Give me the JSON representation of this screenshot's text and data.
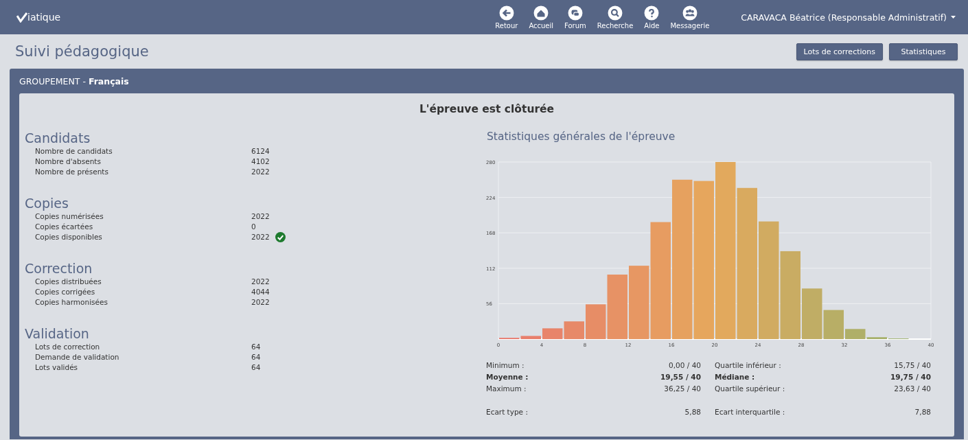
{
  "topbar": {
    "logo": "iatique",
    "nav": [
      {
        "label": "Retour"
      },
      {
        "label": "Accueil"
      },
      {
        "label": "Forum"
      },
      {
        "label": "Recherche"
      },
      {
        "label": "Aide"
      },
      {
        "label": "Messagerie"
      }
    ],
    "user": "CARAVACA Béatrice (Responsable Administratif)"
  },
  "page": {
    "title": "Suivi pédagogique",
    "buttons": [
      "Lots de corrections",
      "Statistiques"
    ]
  },
  "panel": {
    "title": "GROUPEMENT",
    "title_sep": " - ",
    "subject": "Français",
    "status": "L'épreuve est clôturée",
    "sections": [
      {
        "heading": "Candidats",
        "items": [
          {
            "label": "Nombre de candidats",
            "value": "6124",
            "ok": false
          },
          {
            "label": "Nombre d'absents",
            "value": "4102",
            "ok": false
          },
          {
            "label": "Nombre de présents",
            "value": "2022",
            "ok": false
          }
        ]
      },
      {
        "heading": "Copies",
        "items": [
          {
            "label": "Copies numérisées",
            "value": "2022",
            "ok": false
          },
          {
            "label": "Copies écartées",
            "value": "0",
            "ok": false
          },
          {
            "label": "Copies disponibles",
            "value": "2022",
            "ok": true
          }
        ]
      },
      {
        "heading": "Correction",
        "items": [
          {
            "label": "Copies distribuées",
            "value": "2022",
            "ok": false
          },
          {
            "label": "Copies corrigées",
            "value": "4044",
            "ok": false
          },
          {
            "label": "Copies harmonisées",
            "value": "2022",
            "ok": false
          }
        ]
      },
      {
        "heading": "Validation",
        "items": [
          {
            "label": "Lots de correction",
            "value": "64",
            "ok": false
          },
          {
            "label": "Demande de validation",
            "value": "64",
            "ok": false
          },
          {
            "label": "Lots validés",
            "value": "64",
            "ok": false
          }
        ]
      }
    ],
    "chart_title": "Statistiques générales de l'épreuve",
    "chart_data": {
      "type": "bar",
      "x": [
        1,
        3,
        5,
        7,
        9,
        11,
        13,
        15,
        17,
        19,
        21,
        23,
        25,
        27,
        29,
        31,
        33,
        35,
        37,
        39
      ],
      "values": [
        2,
        5,
        17,
        28,
        55,
        102,
        116,
        185,
        252,
        250,
        280,
        239,
        186,
        139,
        80,
        46,
        16,
        3,
        1,
        0
      ],
      "xlim": [
        0,
        40
      ],
      "ylim": [
        0,
        280
      ],
      "xticks": [
        0,
        4,
        8,
        12,
        16,
        20,
        24,
        28,
        32,
        36,
        40
      ],
      "yticks": [
        56,
        112,
        168,
        224,
        280
      ],
      "grid": true
    },
    "stats": [
      [
        [
          {
            "label": "Minimum :",
            "value": "0,00 / 40",
            "bold": false
          },
          {
            "label": "Moyenne :",
            "value": "19,55 / 40",
            "bold": true
          },
          {
            "label": "Maximum :",
            "value": "36,25 / 40",
            "bold": false
          }
        ],
        [
          {
            "label": "Ecart type :",
            "value": "5,88",
            "bold": false
          }
        ]
      ],
      [
        [
          {
            "label": "Quartile inférieur :",
            "value": "15,75 / 40",
            "bold": false
          },
          {
            "label": "Médiane :",
            "value": "19,75 / 40",
            "bold": true
          },
          {
            "label": "Quartile supérieur :",
            "value": "23,63 / 40",
            "bold": false
          }
        ],
        [
          {
            "label": "Ecart interquartile :",
            "value": "7,88",
            "bold": false
          }
        ]
      ]
    ]
  }
}
